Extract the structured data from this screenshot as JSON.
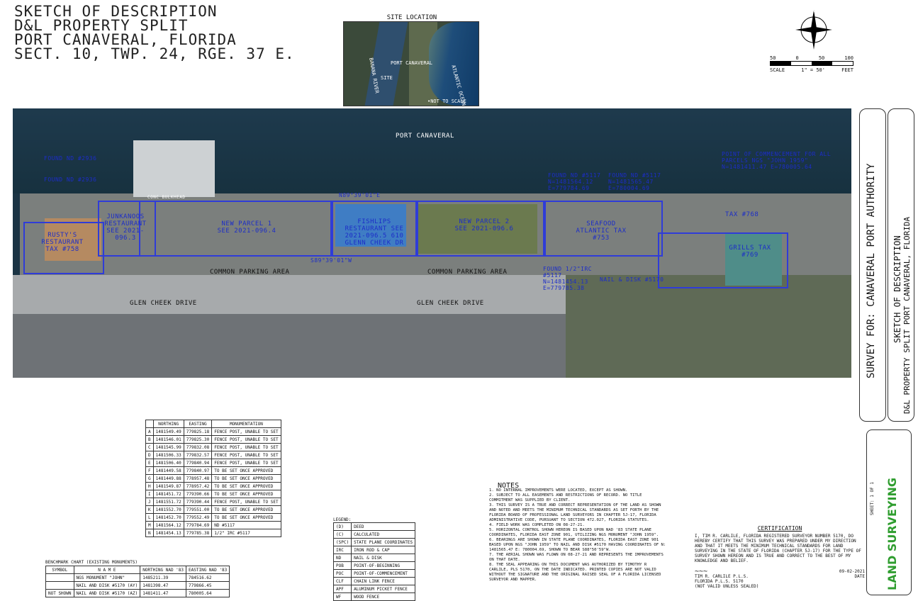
{
  "title": {
    "lines": [
      "SKETCH OF DESCRIPTION",
      "D&L PROPERTY SPLIT",
      "PORT CANAVERAL, FLORIDA",
      "SECT. 10, TWP. 24, RGE. 37 E."
    ]
  },
  "site_location": {
    "title": "SITE LOCATION",
    "labels": {
      "banana_river": "BANANA RIVER",
      "port_canaveral": "PORT CANAVERAL",
      "site": "SITE",
      "atlantic_ocean": "ATLANTIC OCEAN",
      "not_to_scale": "•NOT TO SCALE"
    }
  },
  "scale": {
    "ticks": [
      "50",
      "0",
      "50",
      "100"
    ],
    "label": "SCALE",
    "ratio": "1\" = 50'",
    "unit": "FEET"
  },
  "aerial": {
    "port_canaveral": "PORT CANAVERAL",
    "common_parking_1": "COMMON PARKING AREA",
    "common_parking_2": "COMMON PARKING AREA",
    "glen_cheek_1": "GLEN CHEEK DRIVE",
    "glen_cheek_2": "GLEN CHEEK DRIVE",
    "junkanoos": "JUNKANOOS RESTAURANT SEE 2021-096.3",
    "rustys": "RUSTY'S RESTAURANT TAX #758",
    "new_parcel_1": "NEW PARCEL 1 SEE 2021-096.4",
    "fishlips": "FISHLIPS RESTAURANT SEE 2021-096.5 610 GLENN CHEEK DR",
    "new_parcel_2": "NEW PARCEL 2 SEE 2021-096.6",
    "seafood_atlantic": "SEAFOOD ATLANTIC TAX #753",
    "grills": "GRILLS TAX #769",
    "tax_768": "TAX #768",
    "commencement": "POINT OF COMMENCEMENT FOR ALL PARCELS NGS \"JOHN 1959\" N=1481411.47 E=780005.64",
    "found_5117_a": "FOUND ND #5117 N=1481564.12 E=779784.69",
    "found_5117_b": "FOUND ND #5117 N=1481565.47 E=780004.69",
    "found_2936_a": "FOUND ND #2936",
    "found_2936_b": "FOUND ND #2936",
    "nail_disk": "NAIL & DISK #5170",
    "found_irc": "FOUND 1/2\"IRC #5117 N=1481454.13 E=779785.38",
    "bearing_1": "N89°39'01\"E",
    "bearing_2": "S89°39'01\"W",
    "conc_bulkhead": "CONC BULKHEAD"
  },
  "sidebar": {
    "survey_for": "SURVEY FOR: CANAVERAL PORT AUTHORITY",
    "sketch_line1": "SKETCH OF DESCRIPTION",
    "sketch_line2": "D&L PROPERTY SPLIT PORT CANAVERAL, FLORIDA",
    "sheet": "SHEET: 1 OF 1",
    "company": "LAND SURVEYING"
  },
  "coord_table": {
    "headers": [
      "",
      "NORTHING",
      "EASTING",
      "MONUMENTATION"
    ],
    "rows": [
      [
        "A",
        "1481549.49",
        "779825.18",
        "FENCE POST, UNABLE TO SET"
      ],
      [
        "B",
        "1481546.01",
        "779825.30",
        "FENCE POST, UNABLE TO SET"
      ],
      [
        "C",
        "1481545.99",
        "779832.08",
        "FENCE POST, UNABLE TO SET"
      ],
      [
        "D",
        "1481506.33",
        "779832.57",
        "FENCE POST, UNABLE TO SET"
      ],
      [
        "E",
        "1481506.40",
        "779840.94",
        "FENCE POST, UNABLE TO SET"
      ],
      [
        "F",
        "1481449.58",
        "779840.97",
        "TO BE SET ONCE APPROVED"
      ],
      [
        "G",
        "1481449.88",
        "778957.48",
        "TO BE SET ONCE APPROVED"
      ],
      [
        "H",
        "1481549.87",
        "778957.42",
        "TO BE SET ONCE APPROVED"
      ],
      [
        "I",
        "1481451.72",
        "779390.66",
        "TO BE SET ONCE APPROVED"
      ],
      [
        "J",
        "1481551.72",
        "779390.44",
        "FENCE POST, UNABLE TO SET"
      ],
      [
        "K",
        "1481552.70",
        "779551.00",
        "TO BE SET ONCE APPROVED"
      ],
      [
        "L",
        "1481452.70",
        "779552.49",
        "TO BE SET ONCE APPROVED"
      ],
      [
        "M",
        "1481564.12",
        "779784.69",
        "ND #5117"
      ],
      [
        "N",
        "1481454.13",
        "779785.38",
        "1/2\" IRC #5117"
      ]
    ]
  },
  "benchmark": {
    "title": "BENCHMARK CHART (EXISTING MONUMENTS)",
    "headers": [
      "SYMBOL",
      "N A M E",
      "NORTHING NAD '83",
      "EASTING NAD '83"
    ],
    "rows": [
      [
        "",
        "NGS MONUMENT \"JOHN\"",
        "1485211.39",
        "784516.62"
      ],
      [
        "",
        "NAIL AND DISK #5170 (AY)",
        "1481398.47",
        "779866.45"
      ],
      [
        "NOT SHOWN",
        "NAIL AND DISK #5170 (AZ)",
        "1481411.47",
        "780005.64"
      ]
    ]
  },
  "legend": {
    "title": "LEGEND:",
    "rows": [
      [
        "(D)",
        "DEED"
      ],
      [
        "(C)",
        "CALCULATED"
      ],
      [
        "(SPC)",
        "STATE PLANE COORDINATES"
      ],
      [
        "IRC",
        "IRON ROD & CAP"
      ],
      [
        "ND",
        "NAIL & DISK"
      ],
      [
        "POB",
        "POINT-OF-BEGINNING"
      ],
      [
        "POC",
        "POINT-OF-COMMENCEMENT"
      ],
      [
        "CLF",
        "CHAIN LINK FENCE"
      ],
      [
        "APF",
        "ALUMINUM PICKET FENCE"
      ],
      [
        "WF",
        "WOOD FENCE"
      ]
    ]
  },
  "notes": {
    "title": "NOTES",
    "items": [
      "1. NO INTERNAL IMPROVEMENTS WERE LOCATED, EXCEPT AS SHOWN.",
      "2. SUBJECT TO ALL EASEMENTS AND RESTRICTIONS OF RECORD. NO TITLE COMMITMENT WAS SUPPLIED BY CLIENT.",
      "3. THIS SURVEY IS A TRUE AND CORRECT REPRESENTATION OF THE LAND AS SHOWN AND NOTED AND MEETS THE MINIMUM TECHNICAL STANDARDS AS SET FORTH BY THE FLORIDA BOARD OF PROFESSIONAL LAND SURVEYORS IN CHAPTER 5J-17, FLORIDA ADMINISTRATIVE CODE, PURSUANT TO SECTION 472.027, FLORIDA STATUTES.",
      "4. FIELD WORK WAS COMPLETED ON 08-27-21.",
      "5. HORIZONTAL CONTROL SHOWN HEREON IS BASED UPON NAD '83 STATE PLANE COORDINATES, FLORIDA EAST ZONE 901, UTILIZING NGS MONUMENT \"JOHN 1959\".",
      "6. BEARINGS ARE SHOWN IN STATE PLANE COORDINATES, FLORIDA EAST ZONE 901 BASED UPON NGS \"JOHN 1959\" TO NAIL AND DISK #5170 HAVING COORDINATES OF N: 1481565.47 E: 780004.69, SHOWN TO BEAR S88°50'59\"W.",
      "7. THE AERIAL SHOWN WAS FLOWN ON 08-27-21 AND REPRESENTS THE IMPROVEMENTS ON THAT DATE.",
      "8. THE SEAL APPEARING ON THIS DOCUMENT WAS AUTHORIZED BY TIMOTHY R CARLILE, PLS 5170, ON THE DATE INDICATED. PRINTED COPIES ARE NOT VALID WITHOUT THE SIGNATURE AND THE ORIGINAL RAISED SEAL OF A FLORIDA LICENSED SURVEYOR AND MAPPER."
    ]
  },
  "certification": {
    "title": "CERTIFICATION",
    "body": "I, TIM R. CARLILE, FLORIDA REGISTERED SURVEYOR NUMBER 5170, DO HEREBY CERTIFY THAT THIS SURVEY WAS PREPARED UNDER MY DIRECTION AND THAT IT MEETS THE MINIMUM TECHNICAL STANDARDS FOR LAND SURVEYING IN THE STATE OF FLORIDA (CHAPTER 5J-17) FOR THE TYPE OF SURVEY SHOWN HEREON AND IS TRUE AND CORRECT TO THE BEST OF MY KNOWLEDGE AND BELIEF.",
    "date": "09-02-2021",
    "name": "TIM R. CARLILE P.L.S.",
    "license": "FLORIDA P.L.S. 5170",
    "note": "(NOT VALID UNLESS SEALED)",
    "date_label": "DATE"
  }
}
